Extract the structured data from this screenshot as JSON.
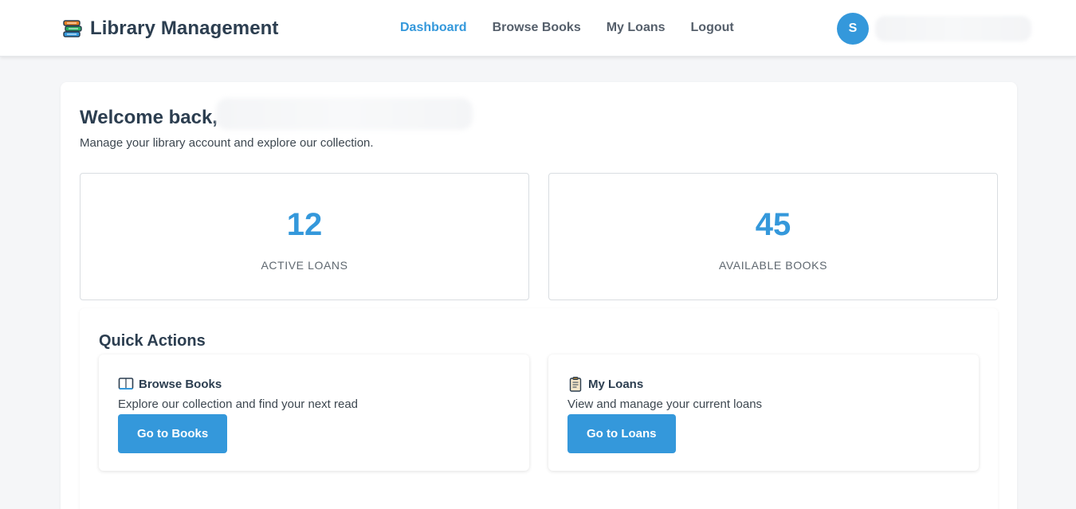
{
  "header": {
    "title": "Library Management",
    "brand_icon": "book-stack-icon",
    "nav": [
      {
        "label": "Dashboard",
        "active": true
      },
      {
        "label": "Browse Books",
        "active": false
      },
      {
        "label": "My Loans",
        "active": false
      },
      {
        "label": "Logout",
        "active": false
      }
    ],
    "avatar_initial": "S"
  },
  "main": {
    "welcome": "Welcome back,",
    "subtitle": "Manage your library account and explore our collection.",
    "stats": [
      {
        "value": "12",
        "label": "ACTIVE LOANS"
      },
      {
        "value": "45",
        "label": "AVAILABLE BOOKS"
      }
    ],
    "quick_actions": {
      "title": "Quick Actions",
      "items": [
        {
          "icon": "open-book-icon",
          "title": "Browse Books",
          "description": "Explore our collection and find your next read",
          "button": "Go to Books"
        },
        {
          "icon": "clipboard-icon",
          "title": "My Loans",
          "description": "View and manage your current loans",
          "button": "Go to Loans"
        }
      ]
    }
  },
  "colors": {
    "accent": "#3498db",
    "text_dark": "#2c3e50",
    "background": "#f5f6f8"
  }
}
